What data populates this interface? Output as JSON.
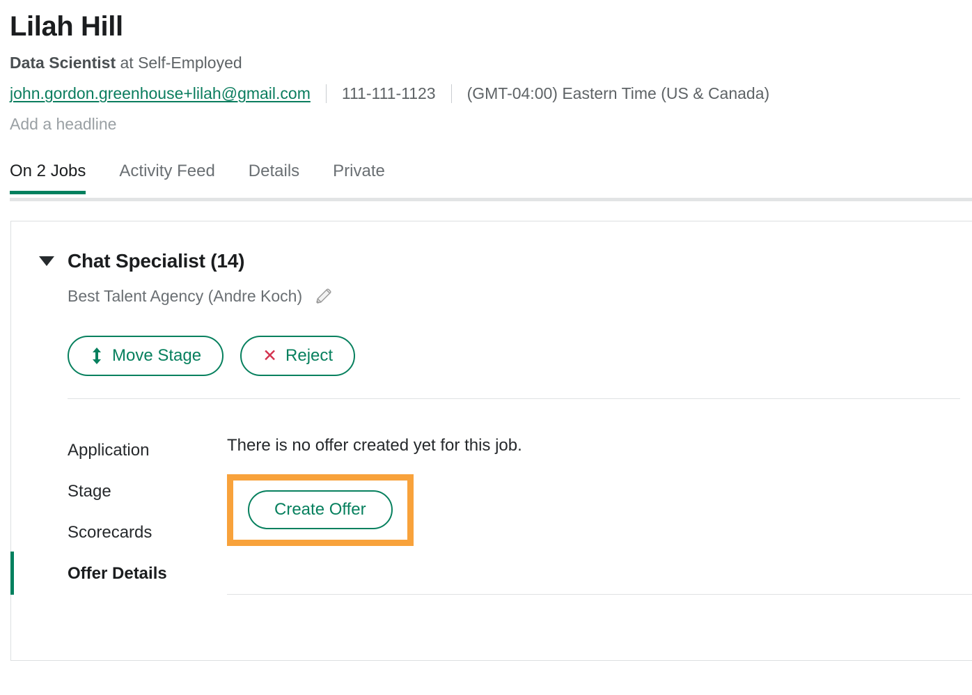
{
  "profile": {
    "name": "Lilah Hill",
    "job_title": "Data Scientist",
    "at_word": "at",
    "company": "Self-Employed",
    "email": "john.gordon.greenhouse+lilah@gmail.com",
    "phone": "111-111-1123",
    "timezone": "(GMT-04:00) Eastern Time (US & Canada)",
    "headline_placeholder": "Add a headline"
  },
  "tabs": [
    {
      "label": "On 2 Jobs",
      "active": true
    },
    {
      "label": "Activity Feed",
      "active": false
    },
    {
      "label": "Details",
      "active": false
    },
    {
      "label": "Private",
      "active": false
    }
  ],
  "job_card": {
    "job_name": "Chat Specialist (14)",
    "agency": "Best Talent Agency (Andre Koch)",
    "edit_icon": "pencil-icon",
    "caret_icon": "caret-down-icon",
    "buttons": {
      "move_stage": {
        "label": "Move Stage",
        "icon": "up-down-arrow-icon"
      },
      "reject": {
        "label": "Reject",
        "icon": "close-x-icon"
      }
    },
    "nav_items": [
      {
        "label": "Application",
        "active": false
      },
      {
        "label": "Stage",
        "active": false
      },
      {
        "label": "Scorecards",
        "active": false
      },
      {
        "label": "Offer Details",
        "active": true
      }
    ],
    "offer_pane": {
      "empty_message": "There is no offer created yet for this job.",
      "create_offer_label": "Create Offer"
    }
  },
  "colors": {
    "accent_green": "#00805E",
    "link_green": "#0B7D5E",
    "highlight_orange": "#F8A23B",
    "reject_red": "#D4334F",
    "text_primary": "#1B1D1F",
    "text_secondary": "#6A6F73",
    "placeholder_gray": "#9AA0A4",
    "border_gray": "#DCDFE1"
  }
}
